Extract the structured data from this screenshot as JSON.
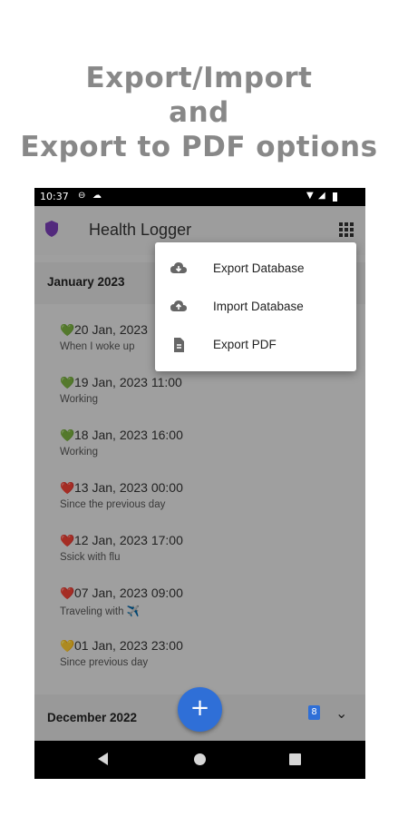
{
  "headline": {
    "line1": "Export/Import",
    "line2": "and",
    "line3": "Export to PDF options"
  },
  "status_bar": {
    "time": "10:37"
  },
  "app": {
    "title": "Health Logger"
  },
  "menu": {
    "items": [
      {
        "label": "Export Database",
        "icon": "cloud-download-icon"
      },
      {
        "label": "Import Database",
        "icon": "cloud-upload-icon"
      },
      {
        "label": "Export PDF",
        "icon": "document-icon"
      }
    ]
  },
  "months": [
    {
      "label": "January 2023",
      "entries": [
        {
          "heart": "💚",
          "date": "20 Jan, 2023",
          "note": "When I woke up"
        },
        {
          "heart": "💚",
          "date": "19 Jan, 2023 11:00",
          "note": "Working"
        },
        {
          "heart": "💚",
          "date": "18 Jan, 2023 16:00",
          "note": "Working"
        },
        {
          "heart": "❤️",
          "date": "13 Jan, 2023 00:00",
          "note": "Since the previous day"
        },
        {
          "heart": "❤️",
          "date": "12 Jan, 2023 17:00",
          "note": "Ssick with flu"
        },
        {
          "heart": "❤️",
          "date": "07 Jan, 2023 09:00",
          "note": "Traveling with ✈️"
        },
        {
          "heart": "💛",
          "date": "01 Jan, 2023 23:00",
          "note": "Since previous day"
        }
      ]
    },
    {
      "label": "December 2022",
      "badge": "8"
    }
  ],
  "fab": {
    "label": "+"
  },
  "colors": {
    "accent": "#2f6fd7",
    "shield": "#7b3fb8"
  }
}
